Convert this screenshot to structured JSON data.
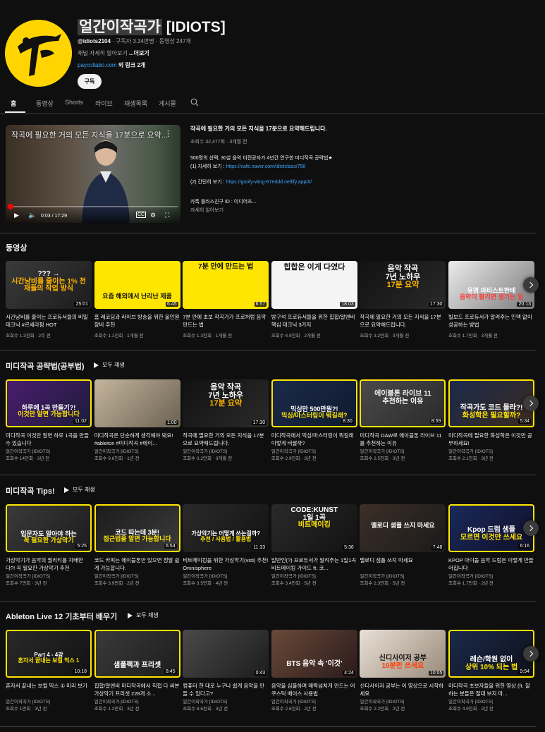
{
  "channel": {
    "name_highlight": "얼간이작곡가",
    "name_rest": " [IDIOTS]",
    "handle": "@idiots2104",
    "stats": " · 구독자 3.34만명 · 동영상 247개",
    "desc": "채널 자세히 알아보기 ",
    "desc_more": "...더보기",
    "link_url": "paycollabo.com",
    "link_extra": " 외 링크 2개",
    "subscribe": "구독",
    "avatar_color": "#ffd400"
  },
  "tabs": [
    "홈",
    "동영상",
    "Shorts",
    "라이브",
    "재생목록",
    "게시물"
  ],
  "featured": {
    "overlay_title": "작곡에 필요한 거의 모든 지식을 17분으로 요약...",
    "time": "0:03 / 17:29",
    "progress": 0.003,
    "title": "작곡에 필요한 거의 모든 지식을 17분으로 요약해드립니다.",
    "meta": "조회수 32,477회 · 3개월 전",
    "lines": [
      {
        "text": "500명의 선택, 30살 음악 비전공자가 4년간 연구한 미디작곡 공략법★",
        "link": ""
      },
      {
        "text": "(1) 자세히 보기 : ",
        "link": "https://cafe.naver.com/idiotclass/758"
      },
      {
        "text": "(2) 간단히 보기 : ",
        "link": "https://goofy-wing-67eddd.netlify.app/#/"
      },
      {
        "text": "카톡 플러스친구 ID : 이디어츠...",
        "link": ""
      }
    ],
    "more": "자세히 알아보기"
  },
  "sections": [
    {
      "title": "동영상",
      "play_all": "",
      "videos": [
        {
          "thumb_text": "??? → | 시간낭비를 줄이는 1% 천재들의 작업 방식",
          "duration": "25:01",
          "title": "시간낭비를 줄이는 프로듀서들의 비밀 테크닉 #르세라핌 HOT",
          "channel": "",
          "meta": "조회수 1.3천회 · 2주 전"
        },
        {
          "thumb_text": "요즘 해외에서 난리난 제품",
          "duration": "6:45",
          "title": "홈 레코딩과 라이브 방송을 위한 올인원 장비 추천",
          "channel": "",
          "meta": "조회수 1.1천회 · 1개월 전"
        },
        {
          "thumb_text": "7분 안에 만드는 법",
          "duration": "6:57",
          "title": "7분 안에 초보 작곡가가 프로처럼 음악 만드는 법",
          "channel": "",
          "meta": "조회수 1.3천회 · 1개월 전"
        },
        {
          "thumb_text": "힙합은 이게 다였다",
          "duration": "18:03",
          "title": "방구석 프로듀서들을 위한 힙합/알앤비 핵심 테크닉 3가지",
          "channel": "",
          "meta": "조회수 4.9천회 · 2개월 전"
        },
        {
          "thumb_text": "음악 작곡 | 7년 노하우 | 17분 요약",
          "duration": "17:30",
          "title": "작곡에 필요한 거의 모든 지식을 17분으로 요약해드립니다.",
          "channel": "",
          "meta": "조회수 3.2만회 · 3개월 전"
        },
        {
          "thumb_text": "유명 아티스트한테 | 음악이 팔리면 생기는 일",
          "duration": "20:13",
          "title": "빌보드 프로듀서가 알려주는 인맥 없이 성공하는 방법",
          "channel": "",
          "meta": "조회수 1.7만회 · 3개월 전"
        }
      ]
    },
    {
      "title": "미디작곡 공략법(공부법)",
      "play_all": "모두 재생",
      "videos": [
        {
          "thumb_text": "하루에 1곡 만들기?! | 이것만 알면 가능합니다",
          "duration": "11:02",
          "title": "미디작곡 이것만 알면 하루 1곡을 만들 수 있습니다",
          "channel": "얼간이작곡가 [IDIOTS]",
          "meta": "조회수 14만회 · 3년 전"
        },
        {
          "thumb_text": "",
          "duration": "1:00",
          "title": "미디작곡은 단순하게 생각해야 돼요! #ableton #미디작곡 #에이...",
          "channel": "얼간이작곡가 [IDIOTS]",
          "meta": "조회수 9.6천회 · 1년 전"
        },
        {
          "thumb_text": "음악 작곡 | 7년 노하우 | 17분 요약",
          "duration": "17:30",
          "title": "작곡에 필요한 거의 모든 지식을 17분으로 요약해드립니다.",
          "channel": "얼간이작곡가 [IDIOTS]",
          "meta": "조회수 3.2만회 · 3개월 전"
        },
        {
          "thumb_text": "믹싱만 500만원?! | 믹싱/마스터링이 뭐길래?",
          "duration": "8:30",
          "title": "미디작곡에서 믹싱/마스터링이 뭐길래 이렇게 비쌀까?",
          "channel": "얼간이작곡가 [IDIOTS]",
          "meta": "조회수 2.9천회 · 3년 전"
        },
        {
          "thumb_text": "에이블톤 라이브 11 | 추천하는 이유",
          "duration": "8:59",
          "title": "미디작곡 DAW로 에이블톤 라이브 11를 추천하는 이유",
          "channel": "얼간이작곡가 [IDIOTS]",
          "meta": "조회수 2.5천회 · 3년 전"
        },
        {
          "thumb_text": "작곡가도 코드 몰라?! | 화성학은 필요할까?",
          "duration": "5:34",
          "title": "미디작곡에 필요한 화성학은 이것만 공부하세요!",
          "channel": "얼간이작곡가 [IDIOTS]",
          "meta": "조회수 2.1천회 · 3년 전"
        }
      ]
    },
    {
      "title": "미디작곡 Tips!",
      "play_all": "모두 재생",
      "videos": [
        {
          "thumb_text": "입문자도 알아야 하는 | 꼭 필요한 가상악기",
          "duration": "5:25",
          "title": "가상악기가 음악의 퀄리티를 지배한다?! 꼭 필요한 가상악기 추천",
          "channel": "얼간이작곡가 [IDIOTS]",
          "meta": "조회수 7만회 · 3년 전"
        },
        {
          "thumb_text": "코드 따는데 3분! | 접근법을 알면 가능합니다",
          "duration": "6:54",
          "title": "코드 카피는 에이블톤만 있으면 정말 쉽게 가능합니다.",
          "channel": "얼간이작곡가 [IDIOTS]",
          "meta": "조회수 3.9만회 · 2년 전"
        },
        {
          "thumb_text": "가상악기는 어떻게 쓰는걸까? | 추천 / 사용법 / 활용법",
          "duration": "11:33",
          "title": "비트메이킹을 위한 가상악기(vsti) 추천! Omnisphere",
          "channel": "얼간이작곡가 [IDIOTS]",
          "meta": "조회수 3.5만회 · 4년 전"
        },
        {
          "thumb_text": "CODE:KUNST | 1일 1곡 | 비트메이킹",
          "duration": "5:36",
          "title": "일반인(?) 프로듀서가 알려주는 1일1곡 비트메이킹 가이드 ft. 코...",
          "channel": "얼간이작곡가 [IDIOTS]",
          "meta": "조회수 3.4만회 · 5년 전"
        },
        {
          "thumb_text": "멜로디 샘플 쓰지 마세요",
          "duration": "7:48",
          "title": "멜로디 샘플 쓰지 마세요",
          "channel": "얼간이작곡가 [IDIOTS]",
          "meta": "조회수 2.3만회 · 5년 전"
        },
        {
          "thumb_text": "Kpop 드럼 샘플 | 모르면 이것만 쓰세요",
          "duration": "6:16",
          "title": "KPOP 아이돌 음악 드럼은 이렇게 만들어집니다",
          "channel": "얼간이작곡가 [IDIOTS]",
          "meta": "조회수 1.7만회 · 2년 전"
        }
      ]
    },
    {
      "title": "Ableton Live 12 기초부터 배우기",
      "play_all": "모두 재생",
      "videos": [
        {
          "thumb_text": "Part 4 - 4강 | 혼자서 끝내는 보컬 믹스 1",
          "duration": "10:18",
          "title": "혼자서 끝내는 보컬 믹스 ① 미리 보기",
          "channel": "얼간이작곡가 [IDIOTS]",
          "meta": "조회수 1만회 · 3년 전"
        },
        {
          "thumb_text": "샘플팩과 프리셋",
          "duration": "8:45",
          "title": "힙합/알앤비 미디작곡에서 직접 다 써본 가상악기 프리셋 228개 소...",
          "channel": "얼간이작곡가 [IDIOTS]",
          "meta": "조회수 1.2만회 · 3년 전"
        },
        {
          "thumb_text": "",
          "duration": "0:43",
          "title": "컴퓨터 한 대로 누구나 쉽게 음악을 만들 수 있다고?",
          "channel": "얼간이작곡가 [IDIOTS]",
          "meta": "조회수 8.6천회 · 3년 전"
        },
        {
          "thumb_text": "BTS 음악 속 '이것'",
          "duration": "4:24",
          "title": "음악을 심플하며 매력넘치게 만드는 어쿠스틱 베이스 사용법",
          "channel": "얼간이작곡가 [IDIOTS]",
          "meta": "조회수 2.6천회 · 2년 전"
        },
        {
          "thumb_text": "신디사이저 공부 | 10분만 쓰세요",
          "duration": "10:05",
          "title": "신디사이저 공부는 이 영상으로 시작하세요",
          "channel": "얼간이작곡가 [IDIOTS]",
          "meta": "조회수 2.2만회 · 2년 전"
        },
        {
          "thumb_text": "레슨/학원 없이 | 상위 10% 되는 법",
          "duration": "9:54",
          "title": "미디작곡 초보자들을 위한 영상 (ft. 잘하는 분들은 절대 보지 마...",
          "channel": "얼간이작곡가 [IDIOTS]",
          "meta": "조회수 4.9천회 · 2년 전"
        }
      ]
    }
  ]
}
